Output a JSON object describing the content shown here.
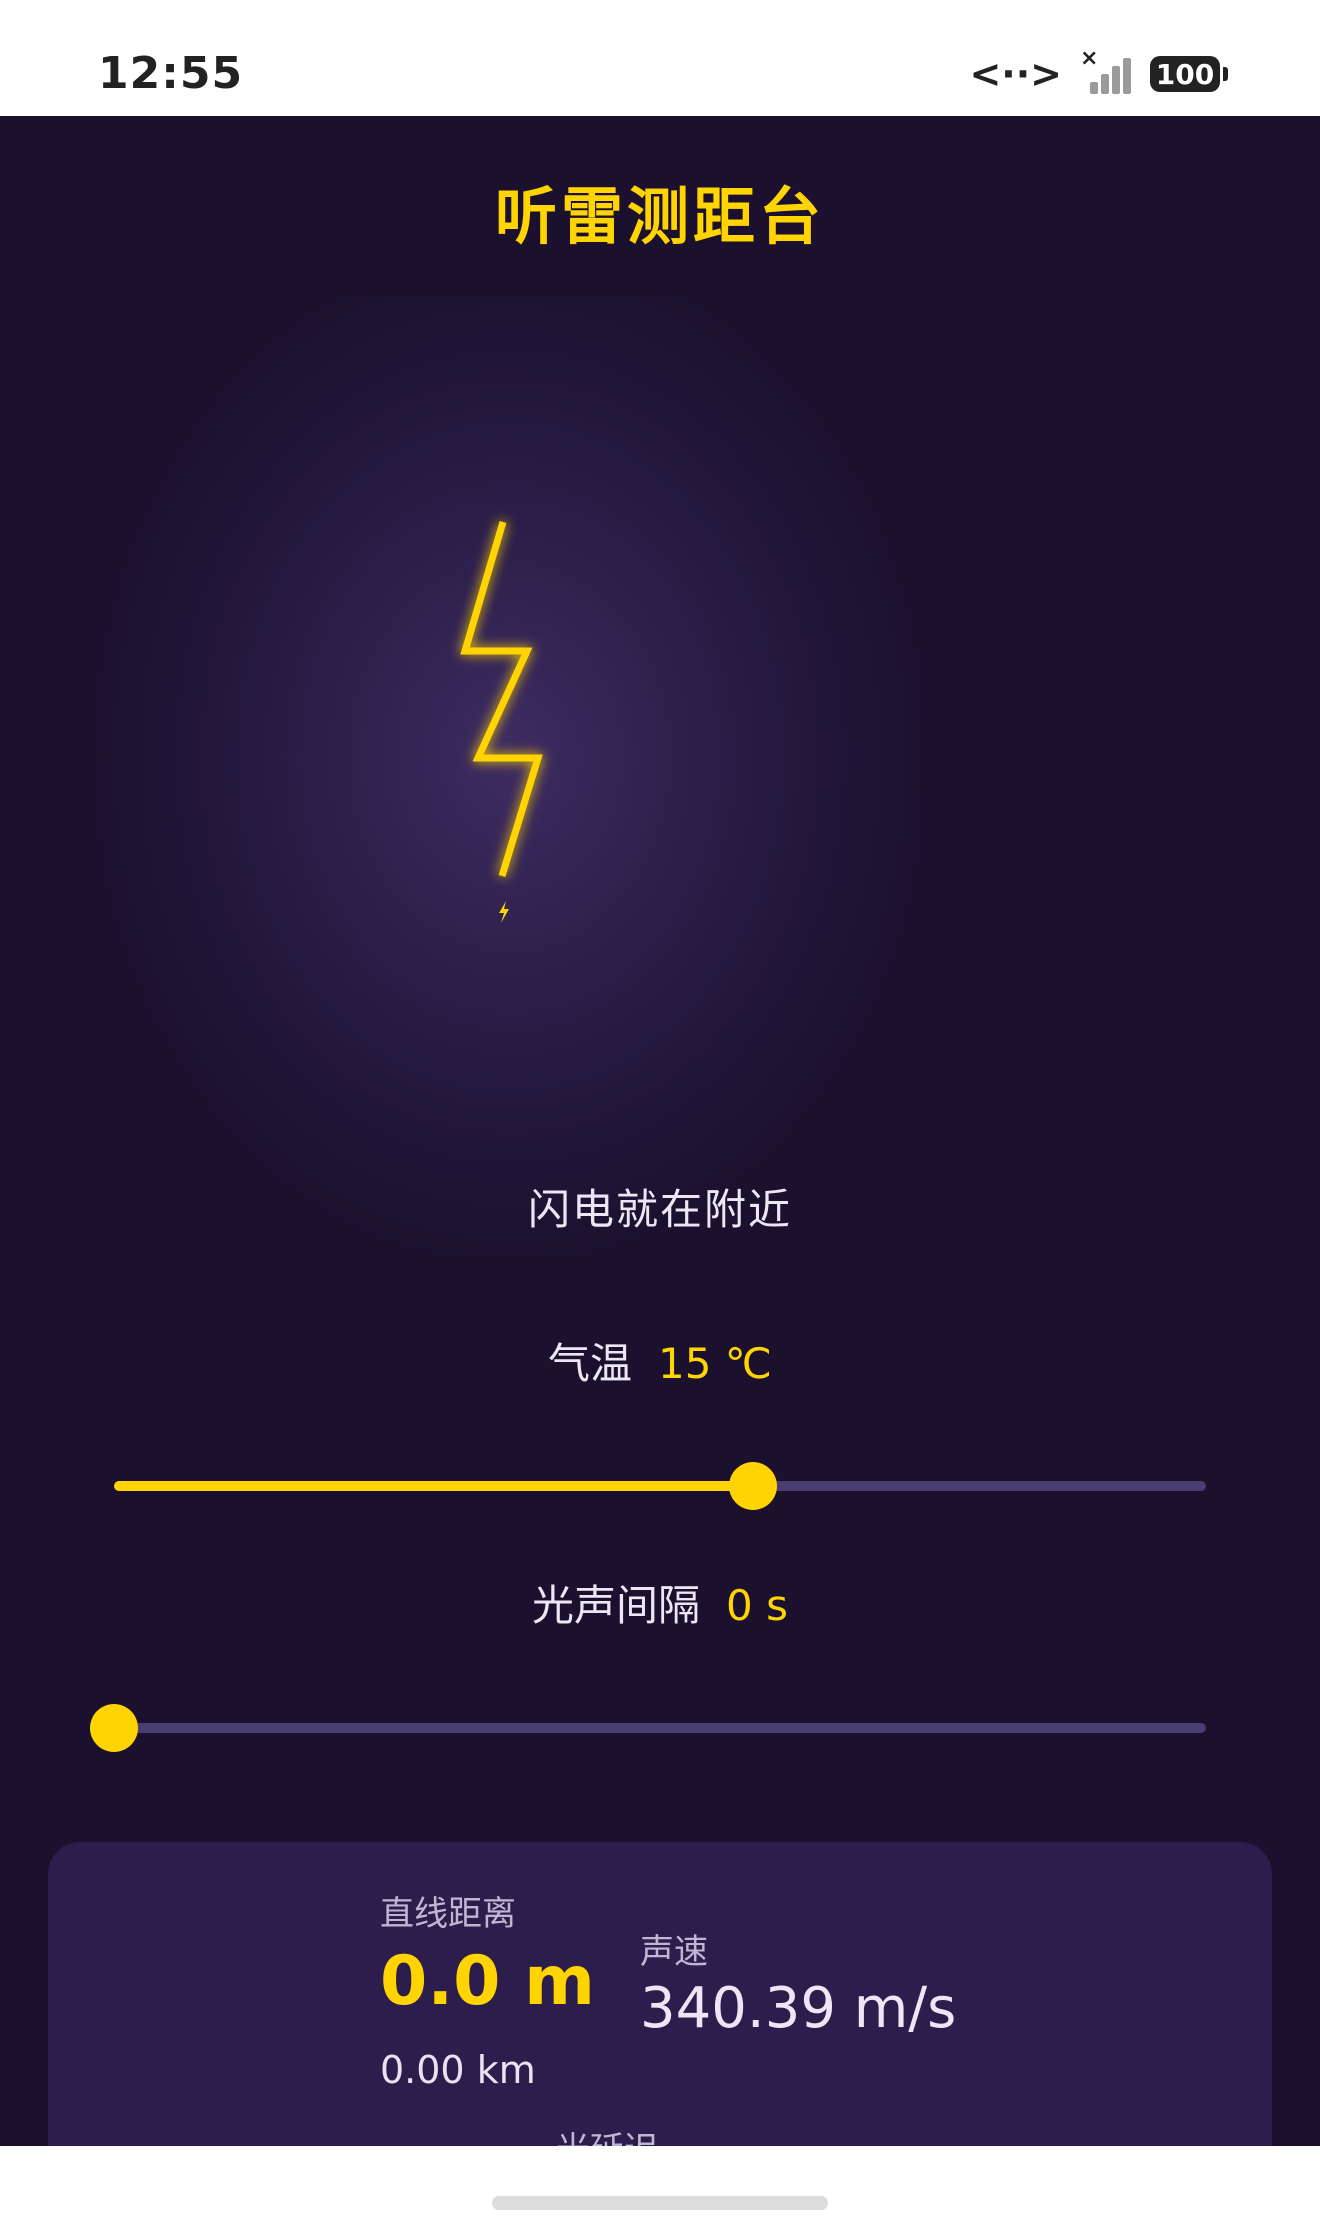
{
  "status_bar": {
    "time": "12:55",
    "network_icon": "<··>",
    "signal_mark": "×",
    "battery": "100"
  },
  "app": {
    "title": "听雷测距台",
    "status_text": "闪电就在附近",
    "temperature": {
      "label": "气温",
      "value": "15 ℃",
      "slider_fraction": 0.585
    },
    "interval": {
      "label": "光声间隔",
      "value": "0 s",
      "slider_fraction": 0.0
    }
  },
  "result_card": {
    "distance_label": "直线距离",
    "distance_m": "0.0 m",
    "distance_km": "0.00 km",
    "speed_label": "声速",
    "speed_value": "340.39 m/s",
    "light_delay_label": "光延迟"
  },
  "colors": {
    "accent": "#ffd400",
    "background": "#1b112f",
    "card": "#2d1d4d",
    "track": "#4a3d72"
  },
  "icons": {
    "bolt": "lightning-bolt-icon",
    "bolt_small": "small-lightning-icon"
  }
}
